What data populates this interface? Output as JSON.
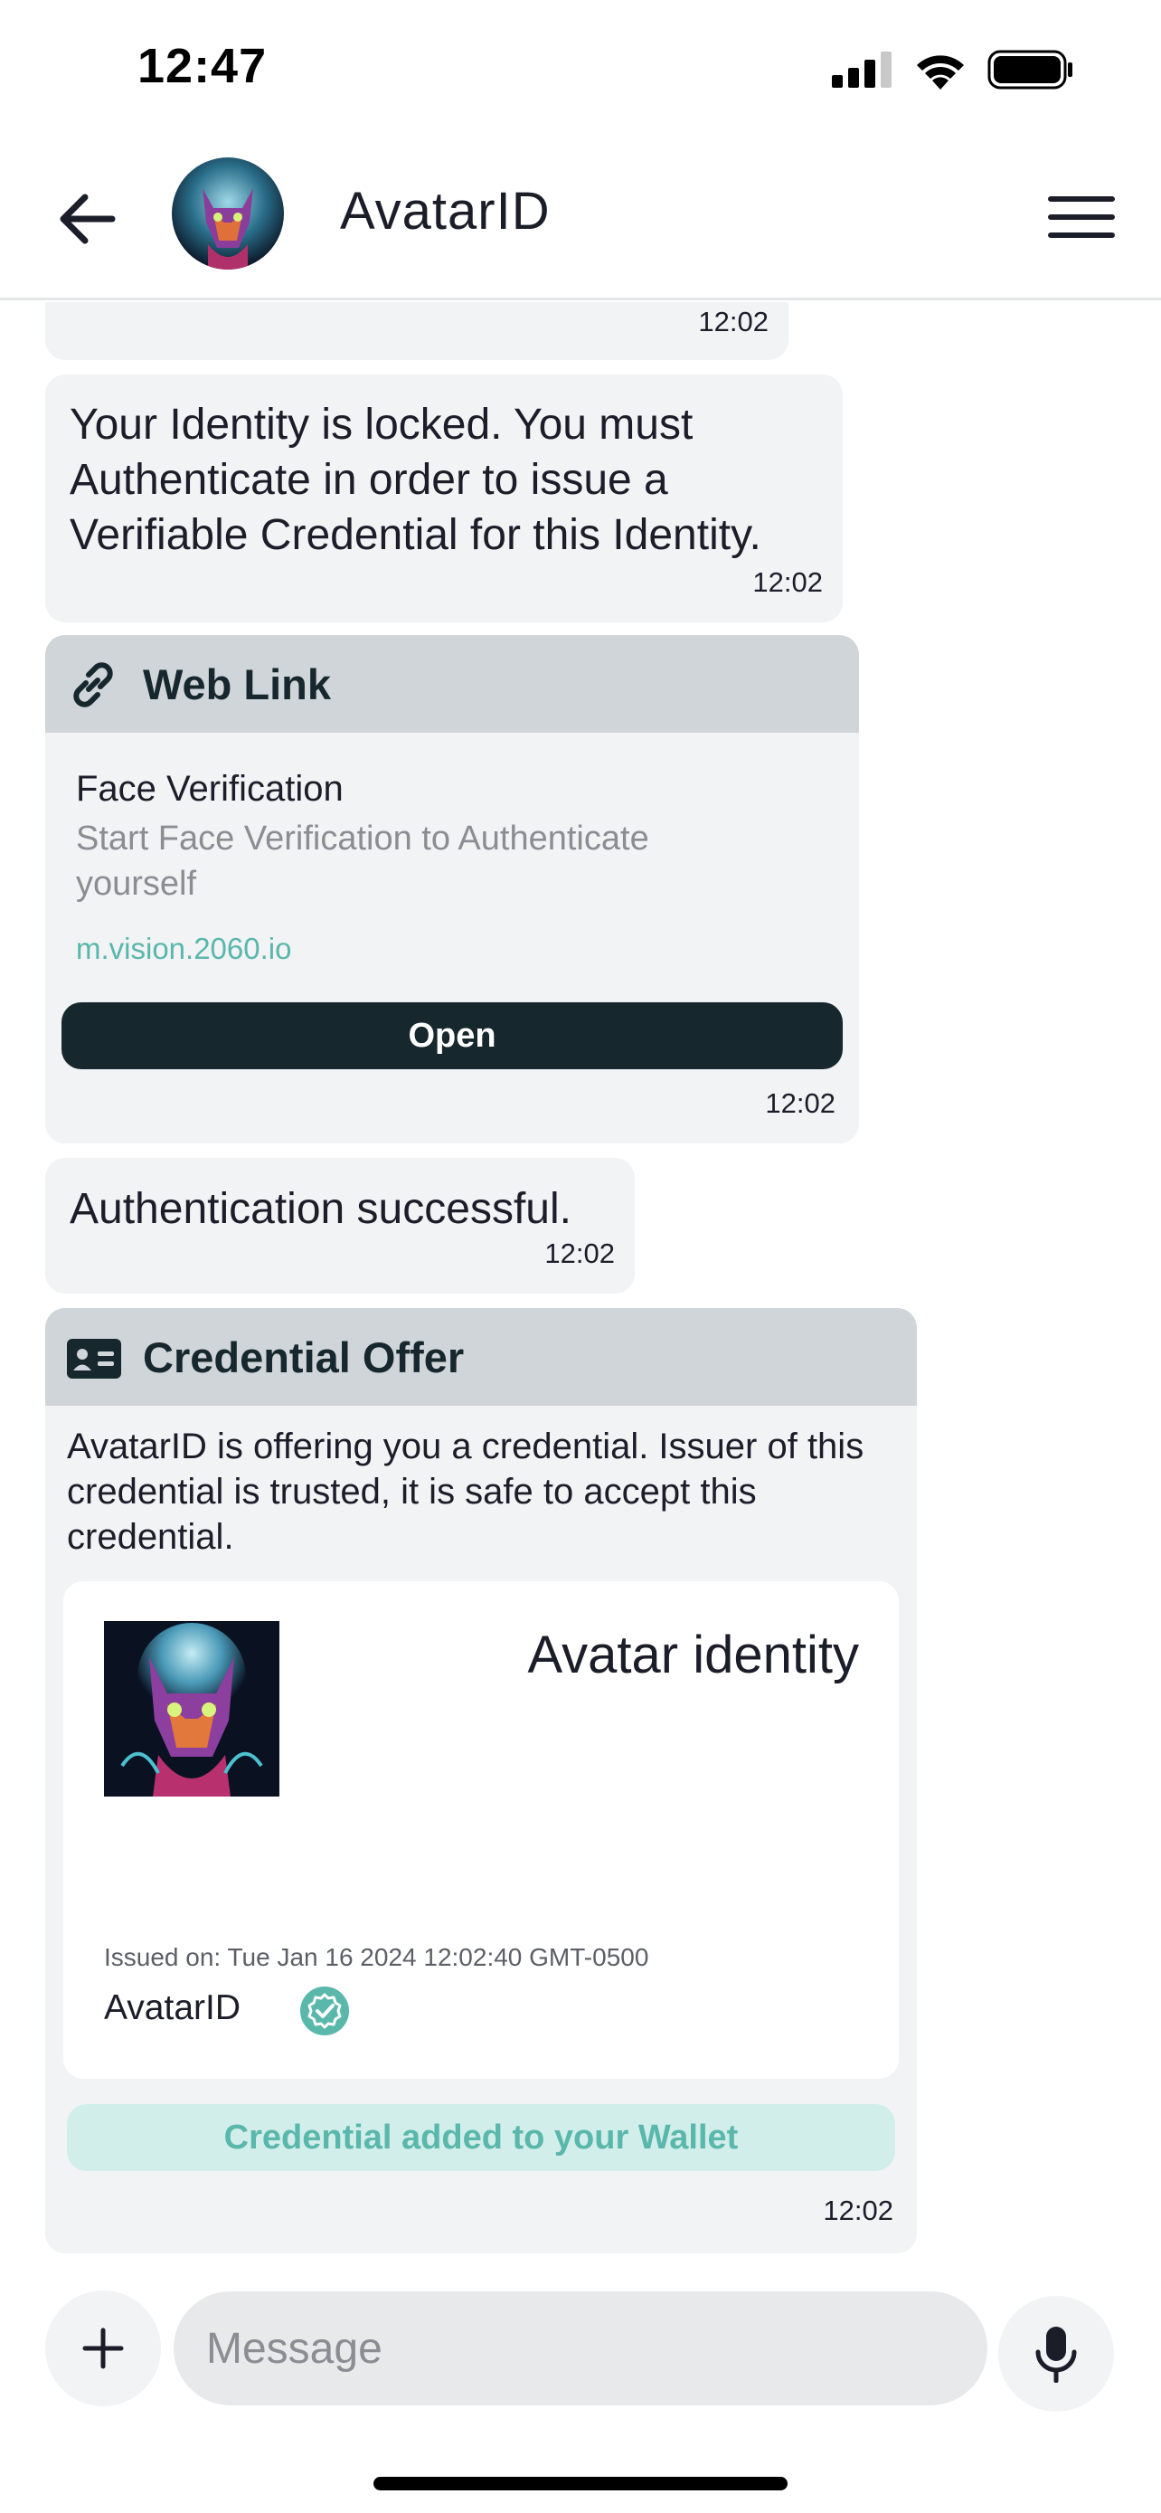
{
  "status_bar": {
    "time": "12:47"
  },
  "header": {
    "title": "AvatarID"
  },
  "messages": {
    "partial": {
      "time": "12:02"
    },
    "locked": {
      "lines": [
        "Your Identity is locked. You must",
        "Authenticate in order to issue a",
        "Verifiable Credential for this Identity."
      ],
      "time": "12:02"
    },
    "web_link": {
      "header": "Web Link",
      "title": "Face Verification",
      "desc_lines": [
        "Start Face Verification to Authenticate",
        "yourself"
      ],
      "url": "m.vision.2060.io",
      "button": "Open",
      "time": "12:02"
    },
    "auth": {
      "text": "Authentication successful.",
      "time": "12:02"
    },
    "credential_offer": {
      "header": "Credential Offer",
      "text_lines": [
        "AvatarID is offering you a credential. Issuer of this",
        "credential is trusted, it is safe to accept this",
        "credential."
      ],
      "card": {
        "title": "Avatar identity",
        "issued": "Issued on: Tue Jan 16 2024 12:02:40 GMT-0500",
        "issuer": "AvatarID"
      },
      "status_button": "Credential added to your Wallet",
      "time": "12:02"
    }
  },
  "composer": {
    "placeholder": "Message"
  },
  "icons": {
    "back": "arrow-left-icon",
    "menu": "hamburger-menu-icon",
    "link": "link-icon",
    "card": "id-card-icon",
    "verified": "verified-badge-icon",
    "plus": "plus-icon",
    "mic": "microphone-icon"
  },
  "colors": {
    "primary_dark": "#16272d",
    "accent_teal": "#5ab7ab",
    "bubble": "#f2f3f5",
    "card_header": "#cfd5d8",
    "wallet_button_bg": "#d1eeeb"
  }
}
